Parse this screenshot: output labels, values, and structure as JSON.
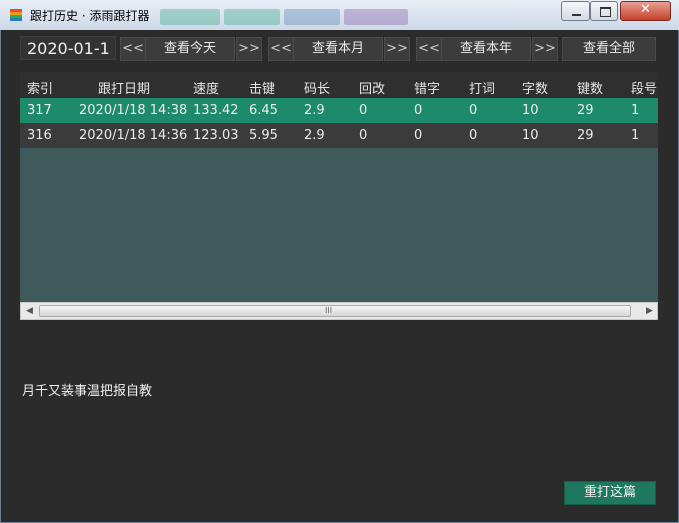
{
  "window": {
    "title": "跟打历史 · 添雨跟打器",
    "controls": {
      "minimize": "minimize",
      "maximize": "maximize",
      "close": "close"
    }
  },
  "toolbar": {
    "date": "2020-01-1",
    "prev": "<<",
    "next": ">>",
    "view_today": "查看今天",
    "view_month": "查看本月",
    "view_year": "查看本年",
    "view_all": "查看全部"
  },
  "table": {
    "columns": [
      "索引",
      "跟打日期",
      "速度",
      "击键",
      "码长",
      "回改",
      "错字",
      "打词",
      "字数",
      "键数",
      "段号"
    ],
    "rows": [
      [
        "317",
        "2020/1/18 14:38",
        "133.42",
        "6.45",
        "2.9",
        "0",
        "0",
        "0",
        "10",
        "29",
        "1"
      ],
      [
        "316",
        "2020/1/18 14:36",
        "123.03",
        "5.95",
        "2.9",
        "0",
        "0",
        "0",
        "10",
        "29",
        "1"
      ]
    ],
    "selected_row": 0,
    "scroll_grip": "III"
  },
  "article_text": "月千又装事温把报自教",
  "retype_button": "重打这篇",
  "colors": {
    "selected_row": "#1e8a6c",
    "grid_background": "#3e5a5a",
    "button_green": "#1e7860"
  }
}
